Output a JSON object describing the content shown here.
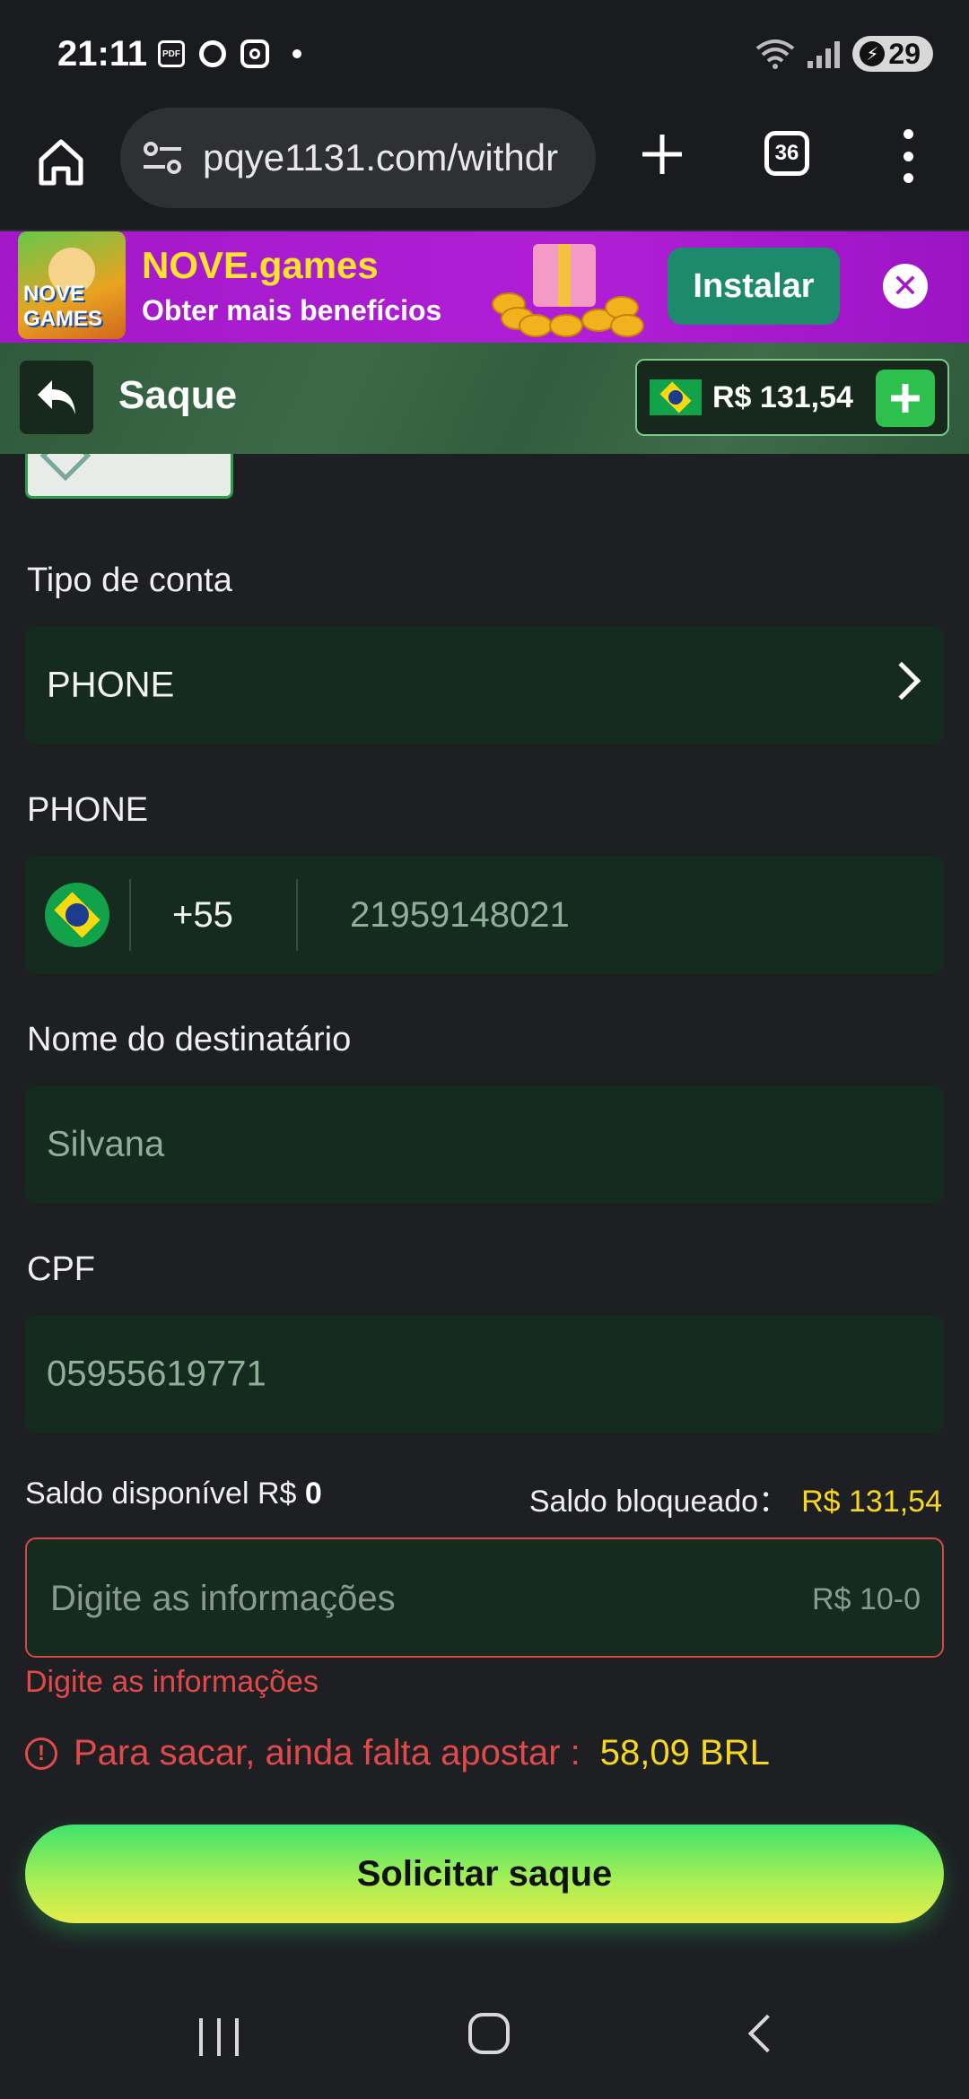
{
  "status_bar": {
    "time": "21:11",
    "pdf_label": "PDF",
    "battery": "29"
  },
  "browser": {
    "url": "pqye1131.com/withdr",
    "tab_count": "36"
  },
  "ad_banner": {
    "logo_text": "NOVE GAMES",
    "title": "NOVE.games",
    "subtitle": "Obter mais benefícios",
    "install_label": "Instalar",
    "close_label": "✕"
  },
  "header": {
    "title": "Saque",
    "balance": "R$ 131,54"
  },
  "form": {
    "account_type_label": "Tipo de conta",
    "account_type_value": "PHONE",
    "phone_label": "PHONE",
    "phone_country_code": "+55",
    "phone_number": "21959148021",
    "recipient_label": "Nome do destinatário",
    "recipient_value": "Silvana",
    "cpf_label": "CPF",
    "cpf_value": "05955619771",
    "available_label": "Saldo disponível R$",
    "available_value": "0",
    "blocked_label": "Saldo bloqueado：",
    "blocked_value": "R$ 131,54",
    "amount_placeholder": "Digite as informações",
    "amount_range": "R$ 10-0",
    "amount_error": "Digite as informações",
    "wager_warning": "Para sacar, ainda falta apostar :",
    "wager_amount": "58,09 BRL",
    "submit_label": "Solicitar saque"
  },
  "colors": {
    "accent_yellow": "#f7d81e",
    "error_red": "#e04a4a",
    "field_bg": "#152b1f",
    "header_green": "#325d3e",
    "ad_purple": "#a318c8"
  }
}
